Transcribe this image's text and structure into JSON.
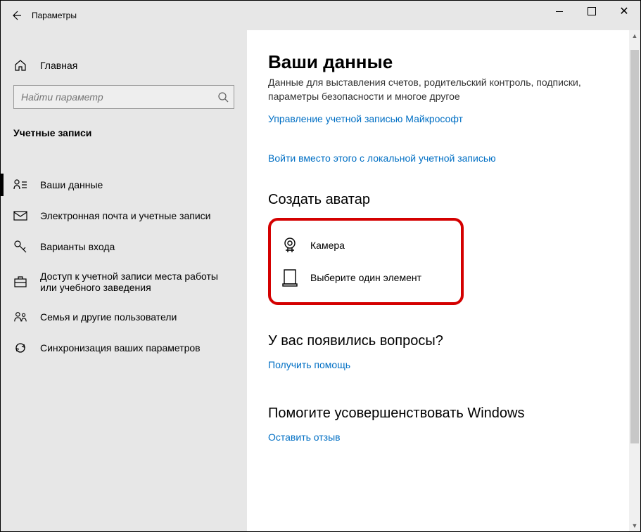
{
  "titlebar": {
    "title": "Параметры"
  },
  "sidebar": {
    "home": "Главная",
    "search_placeholder": "Найти параметр",
    "section": "Учетные записи",
    "items": [
      {
        "label": "Ваши данные"
      },
      {
        "label": "Электронная почта и учетные записи"
      },
      {
        "label": "Варианты входа"
      },
      {
        "label": "Доступ к учетной записи места работы или учебного заведения"
      },
      {
        "label": "Семья и другие пользователи"
      },
      {
        "label": "Синхронизация ваших параметров"
      }
    ]
  },
  "content": {
    "heading": "Ваши данные",
    "desc": "Данные для выставления счетов, родительский контроль, подписки, параметры безопасности и многое другое",
    "manage_link": "Управление учетной записью Майкрософт",
    "local_link": "Войти вместо этого с локальной учетной записью",
    "avatar_heading": "Создать аватар",
    "avatar_options": {
      "camera": "Камера",
      "browse": "Выберите один элемент"
    },
    "questions_heading": "У вас появились вопросы?",
    "get_help": "Получить помощь",
    "improve_heading": "Помогите усовершенствовать Windows",
    "feedback": "Оставить отзыв"
  }
}
